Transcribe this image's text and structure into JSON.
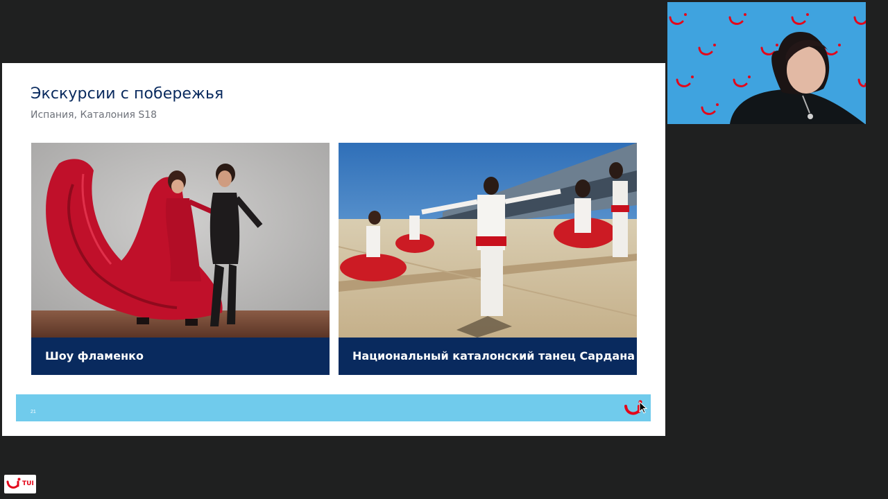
{
  "slide": {
    "title": "Экскурсии с побережья",
    "subtitle": "Испания, Каталония S18",
    "cards": [
      {
        "caption": "Шоу фламенко",
        "photo_icon": "flamenco-dancers-photo"
      },
      {
        "caption": "Национальный каталонский танец Сардана",
        "photo_icon": "sardana-dance-photo"
      }
    ],
    "footer": {
      "page_number": "21",
      "logo_icon": "tui-smile-logo-icon"
    }
  },
  "webcam": {
    "description_icon": "presenter-webcam-video"
  },
  "corner_logo": {
    "text": "TUI"
  },
  "colors": {
    "navy": "#092a5e",
    "footer_blue": "#70cbec",
    "tui_red": "#e3071a",
    "webcam_blue": "#3fa3df",
    "background": "#1f2020"
  }
}
